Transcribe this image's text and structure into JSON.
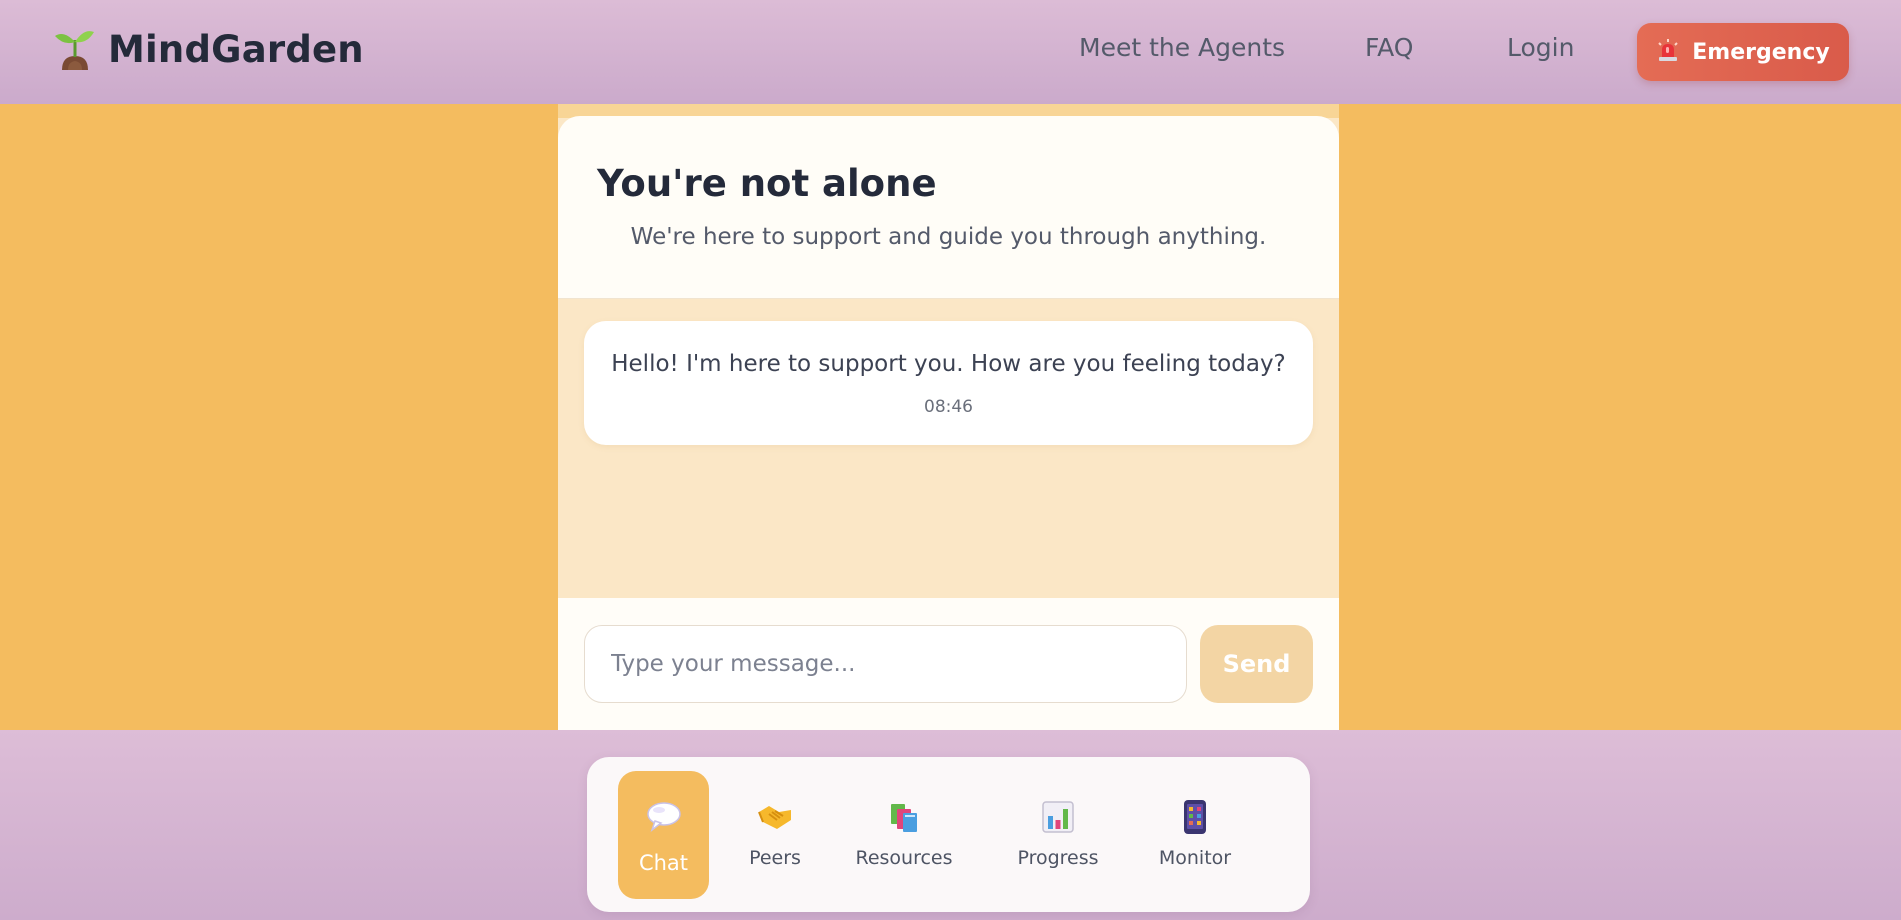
{
  "header": {
    "brand_name": "MindGarden",
    "nav": {
      "agents": "Meet the Agents",
      "faq": "FAQ",
      "login": "Login"
    },
    "emergency_label": "Emergency"
  },
  "hero": {
    "title": "You're not alone",
    "subtitle": "We're here to support and guide you through anything."
  },
  "chat": {
    "messages": [
      {
        "text": "Hello! I'm here to support you. How are you feeling today?",
        "time": "08:46"
      }
    ],
    "input_placeholder": "Type your message...",
    "send_label": "Send"
  },
  "tabs": [
    {
      "label": "Chat",
      "icon": "speech-bubble-icon"
    },
    {
      "label": "Peers",
      "icon": "handshake-icon"
    },
    {
      "label": "Resources",
      "icon": "books-icon"
    },
    {
      "label": "Progress",
      "icon": "bar-chart-icon"
    },
    {
      "label": "Monitor",
      "icon": "phone-icon"
    }
  ],
  "active_tab": "Chat",
  "colors": {
    "accent": "#f4bc5f",
    "emergency": "#e0634e",
    "header_bg": "#d8b8d3",
    "send_disabled": "#f3d5a4"
  }
}
